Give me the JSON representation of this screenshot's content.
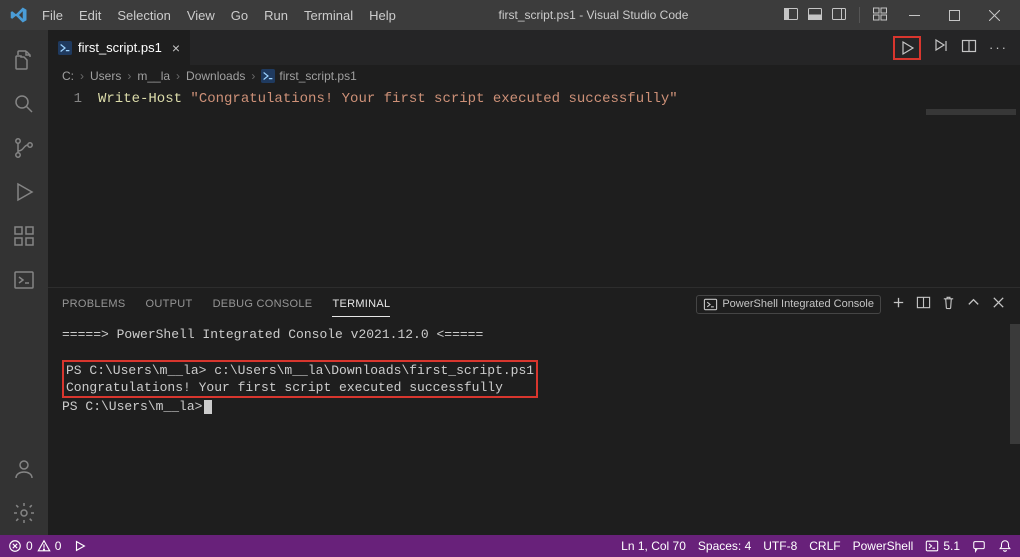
{
  "titlebar": {
    "menu": [
      "File",
      "Edit",
      "Selection",
      "View",
      "Go",
      "Run",
      "Terminal",
      "Help"
    ],
    "title": "first_script.ps1 - Visual Studio Code"
  },
  "tab": {
    "filename": "first_script.ps1",
    "close_icon": "close-icon"
  },
  "breadcrumbs": {
    "segments": [
      "C:",
      "Users",
      "m__la",
      "Downloads"
    ],
    "file": "first_script.ps1"
  },
  "editor": {
    "line_number": "1",
    "command": "Write-Host",
    "string": "\"Congratulations! Your first script executed successfully\""
  },
  "panel": {
    "tabs": {
      "problems": "PROBLEMS",
      "output": "OUTPUT",
      "debug": "DEBUG CONSOLE",
      "terminal": "TERMINAL"
    },
    "dropdown": "PowerShell Integrated Console",
    "terminal": {
      "line1": "=====> PowerShell Integrated Console v2021.12.0 <=====",
      "line2": "PS C:\\Users\\m__la> c:\\Users\\m__la\\Downloads\\first_script.ps1",
      "line3": "Congratulations! Your first script executed successfully",
      "line4_prefix": "PS C:\\Users\\m__la>"
    }
  },
  "statusbar": {
    "errors": "0",
    "warnings": "0",
    "position": "Ln 1, Col 70",
    "spaces": "Spaces: 4",
    "encoding": "UTF-8",
    "eol": "CRLF",
    "language": "PowerShell",
    "feedback": "5.1"
  }
}
